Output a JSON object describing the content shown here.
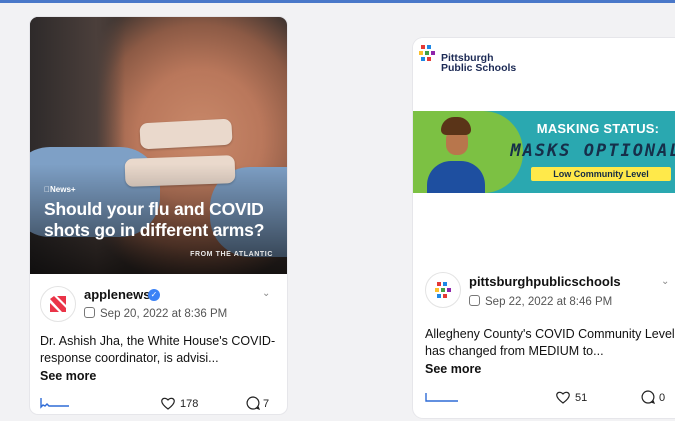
{
  "posts": [
    {
      "hero": {
        "badge": "News+",
        "headline": "Should your flu and COVID shots go in different arms?",
        "source": "FROM THE ATLANTIC"
      },
      "account": "applenews",
      "verified": true,
      "date": "Sep 20, 2022 at 8:36 PM",
      "text": "Dr. Ashish Jha, the White House's COVID-response coordinator, is advisi...",
      "see_more": "See more",
      "likes": "178",
      "comments": "7"
    },
    {
      "hero": {
        "logo_line1": "Pittsburgh",
        "logo_line2": "Public Schools",
        "banner_line1": "MASKING STATUS:",
        "banner_line2": "MASKS OPTIONAL",
        "banner_line3": "Low Community Level"
      },
      "account": "pittsburghpublicschools",
      "verified": false,
      "date": "Sep 22, 2022 at 8:46 PM",
      "text": "Allegheny County's COVID Community Level has changed from MEDIUM to...",
      "see_more": "See more",
      "likes": "51",
      "comments": "0"
    }
  ],
  "colors": {
    "verified": "#3b82f6",
    "applenews_logo": "#ea3448",
    "banner_teal": "#2aa8b0",
    "banner_green": "#7cc143",
    "banner_yellow": "#ffe94a"
  }
}
